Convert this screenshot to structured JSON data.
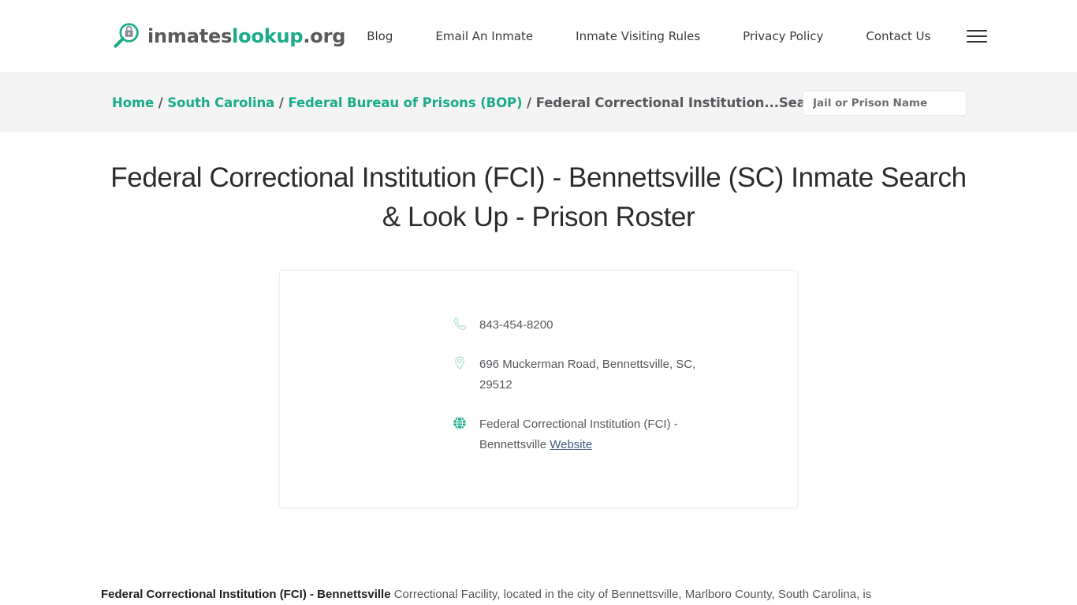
{
  "header": {
    "brand": {
      "icon": "magnifier-lock-logo-icon",
      "part1": "inmates",
      "part2": "lookup",
      "part3": ".org"
    },
    "nav": [
      {
        "label": "Blog",
        "name": "nav-link-blog"
      },
      {
        "label": "Email An Inmate",
        "name": "nav-link-email-an-inmate"
      },
      {
        "label": "Inmate Visiting Rules",
        "name": "nav-link-inmate-visiting-rules"
      },
      {
        "label": "Privacy Policy",
        "name": "nav-link-privacy-policy"
      },
      {
        "label": "Contact Us",
        "name": "nav-link-contact-us"
      }
    ],
    "menu_icon": "hamburger-menu-icon"
  },
  "breadcrumb": {
    "items": [
      {
        "label": "Home",
        "link": true
      },
      {
        "label": "South Carolina",
        "link": true
      },
      {
        "label": "Federal Bureau of Prisons (BOP)",
        "link": true
      },
      {
        "label": "Federal Correctional Institution...Search",
        "link": false
      }
    ],
    "separator": "/"
  },
  "search": {
    "placeholder": "Jail or Prison Name",
    "value": ""
  },
  "page": {
    "title": "Federal Correctional Institution (FCI) - Bennettsville (SC) Inmate Search & Look Up - Prison Roster"
  },
  "facility_card": {
    "phone": {
      "icon": "phone-icon",
      "value": "843-454-8200"
    },
    "address": {
      "icon": "map-pin-icon",
      "value": "696 Muckerman Road, Bennettsville, SC, 29512"
    },
    "website": {
      "icon": "globe-icon",
      "label": "Federal Correctional Institution (FCI) - Bennettsville ",
      "link_text": "Website"
    }
  },
  "description": {
    "bold_lead": "Federal Correctional Institution (FCI) - Bennettsville",
    "rest": " Correctional Facility, located in the city of Bennettsville, Marlboro County, South Carolina, is"
  },
  "colors": {
    "brand_green": "#1aab8b",
    "text_dark": "#2c2c2c",
    "text_muted": "#55585c",
    "bar_bg": "#f4f4f4",
    "link_blue": "#3f5a7d"
  }
}
